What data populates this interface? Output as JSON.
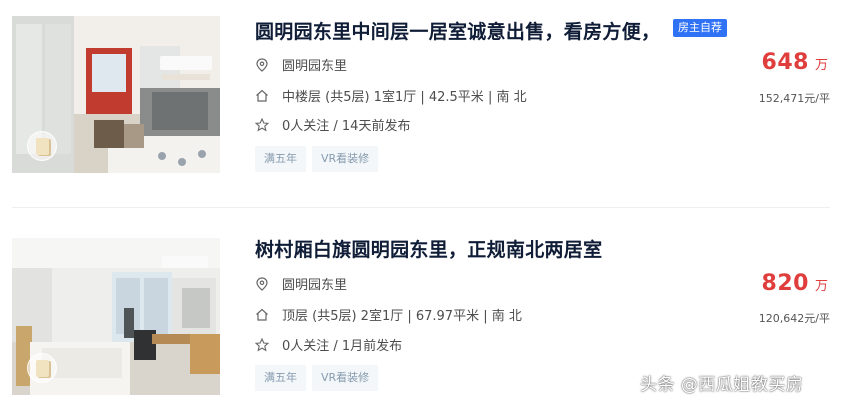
{
  "listings": [
    {
      "title": "圆明园东里中间层一居室诚意出售，看房方便，",
      "tag_badge": "房主自荐",
      "location": "圆明园东里",
      "house_info": "中楼层 (共5层) 1室1厅 | 42.5平米 | 南 北",
      "follow_info": "0人关注 / 14天前发布",
      "tags": [
        "满五年",
        "VR看装修"
      ],
      "total_price": "648",
      "price_unit": "万",
      "unit_price": "152,471元/平"
    },
    {
      "title": "树村厢白旗圆明园东里，正规南北两居室",
      "location": "圆明园东里",
      "house_info": "顶层 (共5层) 2室1厅 | 67.97平米 | 南 北",
      "follow_info": "0人关注 / 1月前发布",
      "tags": [
        "满五年",
        "VR看装修"
      ],
      "total_price": "820",
      "price_unit": "万",
      "unit_price": "120,642元/平"
    }
  ],
  "watermark": "头条 @西瓜姐教买房",
  "colors": {
    "title": "#101d37",
    "price": "#e03d3d",
    "badge": "#3072f6",
    "tag_bg": "#f4f7f9",
    "tag_text": "#849aae"
  }
}
